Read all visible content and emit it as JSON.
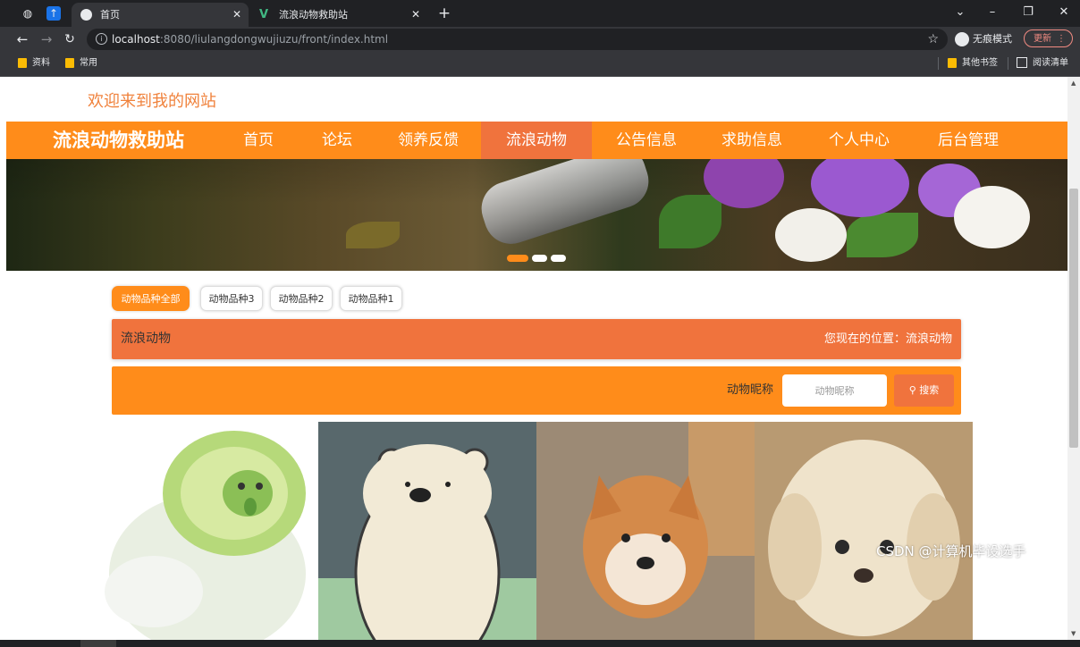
{
  "browser": {
    "tabs": [
      {
        "title": "首页",
        "active": true
      },
      {
        "title": "流浪动物救助站",
        "active": false
      }
    ],
    "url": {
      "host": "localhost",
      "rest": ":8080/liulangdongwujiuzu/front/index.html"
    },
    "incognito_label": "无痕模式",
    "update_label": "更新",
    "bookmarks": [
      "资料",
      "常用"
    ],
    "bookmarks_right": [
      "其他书签",
      "阅读清单"
    ]
  },
  "page": {
    "welcome": "欢迎来到我的网站",
    "site_name": "流浪动物救助站",
    "nav": [
      "首页",
      "论坛",
      "领养反馈",
      "流浪动物",
      "公告信息",
      "求助信息",
      "个人中心",
      "后台管理"
    ],
    "nav_active": "流浪动物",
    "filters": [
      "动物品种全部",
      "动物品种3",
      "动物品种2",
      "动物品种1"
    ],
    "filter_active": "动物品种全部",
    "section_title": "流浪动物",
    "location": "您现在的位置：流浪动物",
    "search_label": "动物昵称",
    "search_placeholder": "动物昵称",
    "search_button": "搜索",
    "cards": [
      {
        "name": "cabbage-dog"
      },
      {
        "name": "ice-bear"
      },
      {
        "name": "shiba-inu"
      },
      {
        "name": "puppy"
      }
    ]
  },
  "colors": {
    "accent": "#ff8c1a",
    "accent_dark": "#f0733d",
    "welcome": "#f0823c"
  },
  "watermark": "CSDN @计算机毕设选手"
}
